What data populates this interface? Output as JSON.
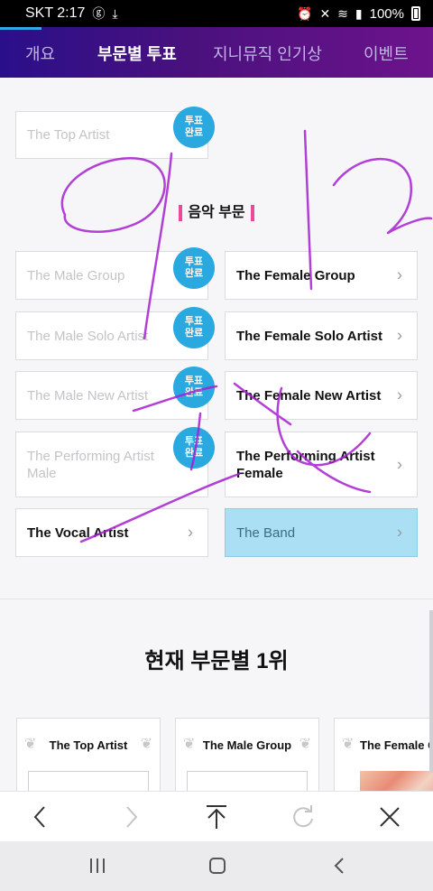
{
  "status_bar": {
    "carrier_time": "SKT 2:17",
    "battery": "100%"
  },
  "tabs": [
    {
      "label": "개요",
      "active": false
    },
    {
      "label": "부문별 투표",
      "active": true
    },
    {
      "label": "지니뮤직 인기상",
      "active": false
    },
    {
      "label": "이벤트",
      "active": false
    }
  ],
  "vote_badge": "투표\n완료",
  "top_artist_card": {
    "label": "The Top Artist",
    "voted": true
  },
  "music_section_title": "음악 부문",
  "categories": [
    {
      "label": "The Male Group",
      "voted": true
    },
    {
      "label": "The Female Group",
      "voted": false
    },
    {
      "label": "The Male Solo Artist",
      "voted": true
    },
    {
      "label": "The Female Solo Artist",
      "voted": false
    },
    {
      "label": "The Male New Artist",
      "voted": true
    },
    {
      "label": "The Female New Artist",
      "voted": false
    },
    {
      "label": "The Performing Artist Male",
      "voted": true
    },
    {
      "label": "The Performing Artist Female",
      "voted": false
    },
    {
      "label": "The Vocal Artist",
      "voted": false
    },
    {
      "label": "The Band",
      "voted": false,
      "selected": true
    }
  ],
  "current_first_title": "현재 부문별 1위",
  "rank_cards": [
    {
      "label": "The Top Artist"
    },
    {
      "label": "The Male Group"
    },
    {
      "label": "The Female Group"
    }
  ],
  "colors": {
    "accent_blue": "#2aa8e0",
    "section_pink": "#e84a9a",
    "selected_card": "#aadff4",
    "scribble": "#a61fd0"
  },
  "icons": {
    "back": "chevron-left-icon",
    "forward": "chevron-right-icon",
    "top": "arrow-up-icon",
    "refresh": "refresh-icon",
    "close": "close-icon"
  }
}
